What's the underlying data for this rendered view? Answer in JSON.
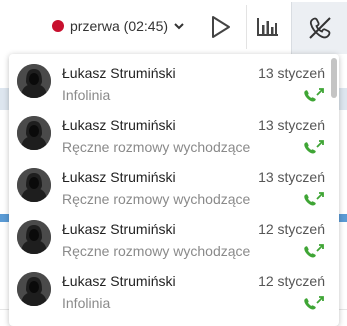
{
  "status": {
    "label": "przerwa (02:45)",
    "color": "#c8102e"
  },
  "toolbar": {
    "play_icon": "play-icon",
    "stats_icon": "bar-chart-icon",
    "hangup_icon": "phone-disabled-icon"
  },
  "calls": [
    {
      "name": "Łukasz Strumiński",
      "date": "13 styczeń",
      "queue": "Infolinia",
      "direction": "outgoing"
    },
    {
      "name": "Łukasz Strumiński",
      "date": "13 styczeń",
      "queue": "Ręczne rozmowy wychodzące",
      "direction": "outgoing"
    },
    {
      "name": "Łukasz Strumiński",
      "date": "13 styczeń",
      "queue": "Ręczne rozmowy wychodzące",
      "direction": "outgoing"
    },
    {
      "name": "Łukasz Strumiński",
      "date": "12 styczeń",
      "queue": "Ręczne rozmowy wychodzące",
      "direction": "outgoing"
    },
    {
      "name": "Łukasz Strumiński",
      "date": "12 styczeń",
      "queue": "Infolinia",
      "direction": "outgoing"
    }
  ],
  "colors": {
    "call_icon": "#3fa535",
    "accent_blue": "#5b9bd5"
  }
}
